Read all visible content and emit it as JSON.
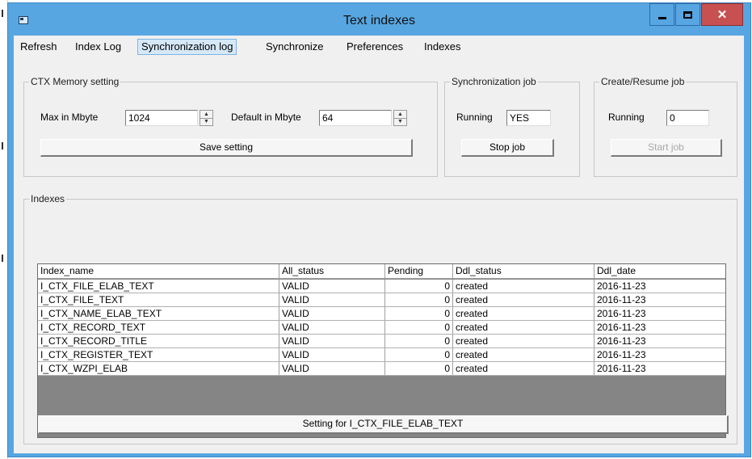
{
  "window": {
    "title": "Text indexes"
  },
  "tabs": [
    "Refresh",
    "Index Log",
    "Synchronization log",
    "Synchronize",
    "Preferences",
    "Indexes"
  ],
  "memory": {
    "label": "CTX Memory setting",
    "max_label": "Max in Mbyte",
    "max_value": "1024",
    "default_label": "Default in Mbyte",
    "default_value": "64",
    "save_button": "Save setting"
  },
  "sync_job": {
    "label": "Synchronization job",
    "running_label": "Running",
    "running_value": "YES",
    "stop_button": "Stop job"
  },
  "create_job": {
    "label": "Create/Resume job",
    "running_label": "Running",
    "running_value": "0",
    "start_button": "Start job"
  },
  "indexes": {
    "label": "Indexes",
    "columns": [
      "Index_name",
      "All_status",
      "Pending",
      "Ddl_status",
      "Ddl_date"
    ],
    "rows": [
      [
        "I_CTX_FILE_ELAB_TEXT",
        "VALID",
        "0",
        "created",
        "2016-11-23"
      ],
      [
        "I_CTX_FILE_TEXT",
        "VALID",
        "0",
        "created",
        "2016-11-23"
      ],
      [
        "I_CTX_NAME_ELAB_TEXT",
        "VALID",
        "0",
        "created",
        "2016-11-23"
      ],
      [
        "I_CTX_RECORD_TEXT",
        "VALID",
        "0",
        "created",
        "2016-11-23"
      ],
      [
        "I_CTX_RECORD_TITLE",
        "VALID",
        "0",
        "created",
        "2016-11-23"
      ],
      [
        "I_CTX_REGISTER_TEXT",
        "VALID",
        "0",
        "created",
        "2016-11-23"
      ],
      [
        "I_CTX_WZPI_ELAB",
        "VALID",
        "0",
        "created",
        "2016-11-23"
      ]
    ],
    "setting_button": "Setting for I_CTX_FILE_ELAB_TEXT"
  },
  "colors": {
    "titlebar": "#58a6e1",
    "close": "#c75050",
    "active_tab": "#d5e8f8",
    "grid_background": "#858585"
  }
}
